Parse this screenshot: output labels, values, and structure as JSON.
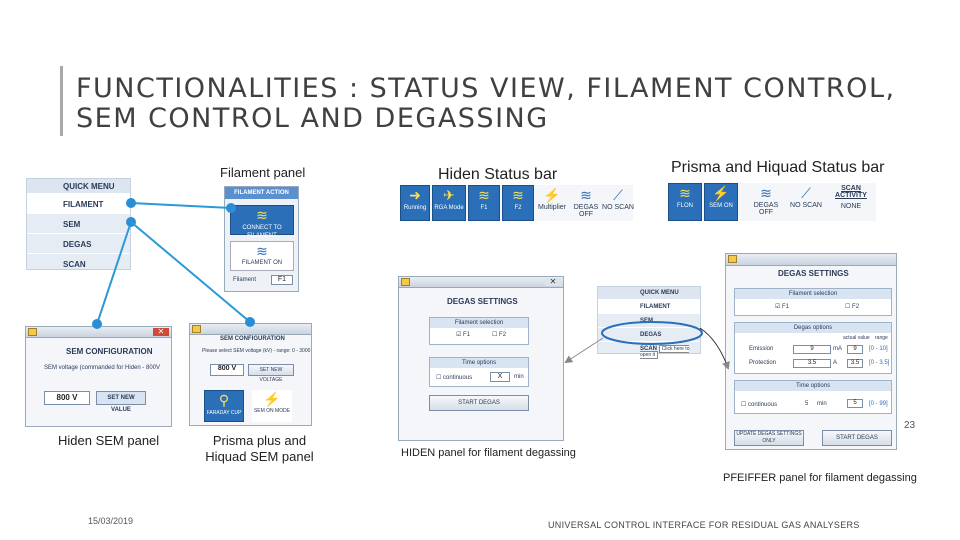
{
  "title": "FUNCTIONALITIES : STATUS VIEW, FILAMENT CONTROL, SEM CONTROL AND DEGASSING",
  "labels": {
    "filament_panel": "Filament panel",
    "hiden_status_bar": "Hiden Status bar",
    "prisma_status_bar": "Prisma and Hiquad Status bar",
    "hiden_sem_panel": "Hiden SEM panel",
    "prisma_sem_panel": "Prisma plus and Hiquad SEM panel",
    "hiden_degas_panel": "HIDEN panel for filament degassing",
    "pfeiffer_degas_panel": "PFEIFFER panel for filament degassing",
    "slide_number": "23",
    "date": "15/03/2019",
    "footer": "UNIVERSAL CONTROL INTERFACE FOR RESIDUAL GAS ANALYSERS"
  },
  "quick_menu": {
    "header": "QUICK MENU",
    "items": [
      "FILAMENT",
      "SEM",
      "DEGAS",
      "SCAN"
    ]
  },
  "filament_window": {
    "title": "FILAMENT ACTION",
    "btn1": "CONNECT TO FILAMENT",
    "btn2": "FILAMENT ON",
    "filament": "Filament",
    "value": "F1"
  },
  "hiden_status": {
    "items": [
      "Running",
      "RGA Mode",
      "F1",
      "F2",
      "Multiplier",
      "DEGAS OFF",
      "NO SCAN"
    ]
  },
  "prisma_status": {
    "items": [
      "FLON",
      "SEM ON",
      "DEGAS OFF",
      "NO SCAN"
    ],
    "scan_activity": "SCAN ACTIVITY",
    "scan_value": "NONE"
  },
  "hiden_sem": {
    "title": "SEM CONFIGURATION",
    "line": "SEM voltage (commanded for Hiden - 800V",
    "value": "800",
    "unit": "V",
    "button": "SET NEW VALUE"
  },
  "prisma_sem": {
    "title": "SEM CONFIGURATION",
    "line": "Please select SEM voltage (kV) - range: 0 - 3000",
    "value": "800",
    "unit": "V",
    "button": "SET NEW VOLTAGE",
    "mode1": "FARADAY CUP",
    "mode2": "SEM ON MODE"
  },
  "hiden_degas": {
    "title": "DEGAS SETTINGS",
    "fil_sel": "Filament selection",
    "f1": "F1",
    "f2": "F2",
    "time_options": "Time options",
    "continuous": "continuous",
    "time_value": "X",
    "time_unit": "min",
    "start": "START DEGAS"
  },
  "mini_menu": {
    "header": "QUICK MENU",
    "items": [
      "FILAMENT",
      "SEM",
      "DEGAS",
      "SCAN"
    ],
    "hint": "Click here to open it"
  },
  "pfeiffer_degas": {
    "title": "DEGAS SETTINGS",
    "fil_sel": "Filament selection",
    "f1": "F1",
    "f2": "F2",
    "degas_options": "Degas options",
    "actual_value": "actual value",
    "range": "range",
    "emission": "Emission",
    "emission_val": "9",
    "emission_unit": "mA",
    "emission_actual": "9",
    "emission_range": "[0 - 10]",
    "protection": "Protection",
    "protection_val": "3.5",
    "protection_unit": "A",
    "protection_actual": "3.5",
    "protection_range": "[0 - 3.5]",
    "time_options": "Time options",
    "continuous": "continuous",
    "time_value": "5",
    "time_unit": "min",
    "time_actual": "5",
    "time_range": "[0 - 99]",
    "update": "UPDATE DEGAS SETTINGS ONLY",
    "start": "START DEGAS"
  }
}
